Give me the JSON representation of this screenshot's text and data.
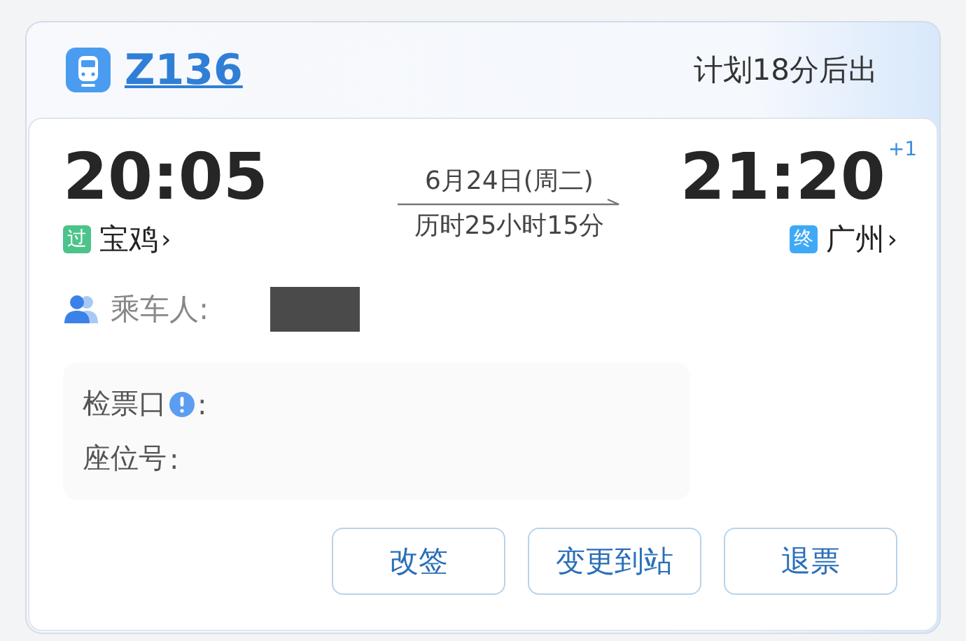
{
  "header": {
    "train_number": "Z136",
    "status": "计划18分后出"
  },
  "departure": {
    "time": "20:05",
    "tag": {
      "text": "过",
      "color": "#4cc38a"
    },
    "station": "宝鸡",
    "chevron": "›"
  },
  "journey": {
    "date": "6月24日(周二)",
    "duration": "历时25小时15分"
  },
  "arrival": {
    "time": "21:20",
    "day_offset": "+1",
    "tag": {
      "text": "终",
      "color": "#3fa9f5"
    },
    "station": "广州",
    "chevron": "›"
  },
  "passenger": {
    "label": "乘车人:"
  },
  "details": [
    {
      "label": "检票口",
      "info_icon": true,
      "colon": ":"
    },
    {
      "label": "座位号",
      "info_icon": false,
      "colon": ":"
    }
  ],
  "buttons": [
    "改签",
    "变更到站",
    "退票"
  ]
}
